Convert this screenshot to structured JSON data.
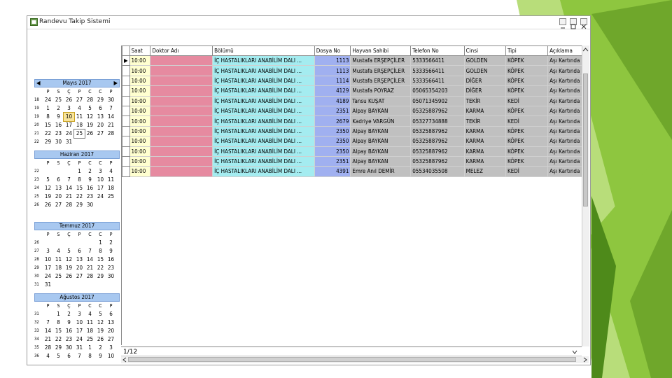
{
  "colors": {
    "green_dark": "#4e8a1a",
    "green_mid": "#6fa72b",
    "green_light": "#8ec63f",
    "green_pale": "#b8dd7a"
  },
  "window": {
    "title": "Randevu Takip Sistemi"
  },
  "calendar": {
    "weekdays": [
      "P",
      "S",
      "Ç",
      "P",
      "C",
      "C",
      "P"
    ],
    "months": [
      {
        "title": "Mayıs 2017",
        "rows": [
          {
            "wk": "18",
            "days": [
              "24",
              "25",
              "26",
              "27",
              "28",
              "29",
              "30"
            ]
          },
          {
            "wk": "19",
            "days": [
              "1",
              "2",
              "3",
              "4",
              "5",
              "6",
              "7"
            ]
          },
          {
            "wk": "19",
            "days": [
              "8",
              "9",
              "10",
              "11",
              "12",
              "13",
              "14"
            ]
          },
          {
            "wk": "20",
            "days": [
              "15",
              "16",
              "17",
              "18",
              "19",
              "20",
              "21"
            ]
          },
          {
            "wk": "21",
            "days": [
              "22",
              "23",
              "24",
              "25",
              "26",
              "27",
              "28"
            ]
          },
          {
            "wk": "22",
            "days": [
              "29",
              "30",
              "31",
              "",
              "",
              "",
              ""
            ]
          }
        ]
      },
      {
        "title": "Haziran 2017",
        "rows": [
          {
            "wk": "22",
            "days": [
              "",
              "",
              "",
              "1",
              "2",
              "3",
              "4"
            ]
          },
          {
            "wk": "23",
            "days": [
              "5",
              "6",
              "7",
              "8",
              "9",
              "10",
              "11"
            ]
          },
          {
            "wk": "24",
            "days": [
              "12",
              "13",
              "14",
              "15",
              "16",
              "17",
              "18"
            ]
          },
          {
            "wk": "25",
            "days": [
              "19",
              "20",
              "21",
              "22",
              "23",
              "24",
              "25"
            ]
          },
          {
            "wk": "26",
            "days": [
              "26",
              "27",
              "28",
              "29",
              "30",
              "",
              ""
            ]
          }
        ]
      },
      {
        "title": "Temmuz 2017",
        "rows": [
          {
            "wk": "26",
            "days": [
              "",
              "",
              "",
              "",
              "",
              "1",
              "2"
            ]
          },
          {
            "wk": "27",
            "days": [
              "3",
              "4",
              "5",
              "6",
              "7",
              "8",
              "9"
            ]
          },
          {
            "wk": "28",
            "days": [
              "10",
              "11",
              "12",
              "13",
              "14",
              "15",
              "16"
            ]
          },
          {
            "wk": "29",
            "days": [
              "17",
              "18",
              "19",
              "20",
              "21",
              "22",
              "23"
            ]
          },
          {
            "wk": "30",
            "days": [
              "24",
              "25",
              "26",
              "27",
              "28",
              "29",
              "30"
            ]
          },
          {
            "wk": "31",
            "days": [
              "31",
              "",
              "",
              "",
              "",
              "",
              ""
            ]
          }
        ]
      },
      {
        "title": "Ağustos 2017",
        "rows": [
          {
            "wk": "31",
            "days": [
              "",
              "1",
              "2",
              "3",
              "4",
              "5",
              "6"
            ]
          },
          {
            "wk": "32",
            "days": [
              "7",
              "8",
              "9",
              "10",
              "11",
              "12",
              "13"
            ]
          },
          {
            "wk": "33",
            "days": [
              "14",
              "15",
              "16",
              "17",
              "18",
              "19",
              "20"
            ]
          },
          {
            "wk": "34",
            "days": [
              "21",
              "22",
              "23",
              "24",
              "25",
              "26",
              "27"
            ]
          },
          {
            "wk": "35",
            "days": [
              "28",
              "29",
              "30",
              "31",
              "1",
              "2",
              "3"
            ]
          },
          {
            "wk": "36",
            "days": [
              "4",
              "5",
              "6",
              "7",
              "8",
              "9",
              "10"
            ]
          }
        ]
      }
    ]
  },
  "table": {
    "columns": [
      "Saat",
      "Doktor Adı",
      "Bölümü",
      "Dosya No",
      "Hayvan Sahibi",
      "Telefon No",
      "Cinsi",
      "Tipi",
      "Açıklama"
    ],
    "rows": [
      [
        "10:00",
        "",
        "İÇ HASTALIKLARI ANABİLİM DALI ...",
        "1113",
        "Mustafa ERŞEPÇİLER",
        "5333566411",
        "GOLDEN",
        "KÖPEK",
        "Aşı Kartında"
      ],
      [
        "10:00",
        "",
        "İÇ HASTALIKLARI ANABİLİM DALI ...",
        "1113",
        "Mustafa ERŞEPÇİLER",
        "5333566411",
        "GOLDEN",
        "KÖPEK",
        "Aşı Kartında"
      ],
      [
        "10:00",
        "",
        "İÇ HASTALIKLARI ANABİLİM DALI ...",
        "1114",
        "Mustafa ERŞEPÇİLER",
        "5333566411",
        "DİĞER",
        "KÖPEK",
        "Aşı Kartında"
      ],
      [
        "10:00",
        "",
        "İÇ HASTALIKLARI ANABİLİM DALI ...",
        "4129",
        "Mustafa POYRAZ",
        "05065354203",
        "DİĞER",
        "KÖPEK",
        "Aşı Kartında"
      ],
      [
        "10:00",
        "",
        "İÇ HASTALIKLARI ANABİLİM DALI ...",
        "4189",
        "Tansu KUŞAT",
        "05071345902",
        "TEKİR",
        "KEDİ",
        "Aşı Kartında"
      ],
      [
        "10:00",
        "",
        "İÇ HASTALIKLARI ANABİLİM DALI ...",
        "2351",
        "Alpay BAYKAN",
        "05325887962",
        "KARMA",
        "KÖPEK",
        "Aşı Kartında"
      ],
      [
        "10:00",
        "",
        "İÇ HASTALIKLARI ANABİLİM DALI ...",
        "2679",
        "Kadriye VARGÜN",
        "05327734888",
        "TEKİR",
        "KEDİ",
        "Aşı Kartında"
      ],
      [
        "10:00",
        "",
        "İÇ HASTALIKLARI ANABİLİM DALI ...",
        "2350",
        "Alpay BAYKAN",
        "05325887962",
        "KARMA",
        "KÖPEK",
        "Aşı Kartında"
      ],
      [
        "10:00",
        "",
        "İÇ HASTALIKLARI ANABİLİM DALI ...",
        "2350",
        "Alpay BAYKAN",
        "05325887962",
        "KARMA",
        "KÖPEK",
        "Aşı Kartında"
      ],
      [
        "10:00",
        "",
        "İÇ HASTALIKLARI ANABİLİM DALI ...",
        "2350",
        "Alpay BAYKAN",
        "05325887962",
        "KARMA",
        "KÖPEK",
        "Aşı Kartında"
      ],
      [
        "10:00",
        "",
        "İÇ HASTALIKLARI ANABİLİM DALI ...",
        "2351",
        "Alpay BAYKAN",
        "05325887962",
        "KARMA",
        "KÖPEK",
        "Aşı Kartında"
      ],
      [
        "10:00",
        "",
        "İÇ HASTALIKLARI ANABİLİM DALI ...",
        "4391",
        "Emre Anıl DEMİR",
        "05534035508",
        "MELEZ",
        "KEDİ",
        "Aşı Kartında"
      ]
    ]
  },
  "footer": {
    "record_counter": "1/12"
  }
}
